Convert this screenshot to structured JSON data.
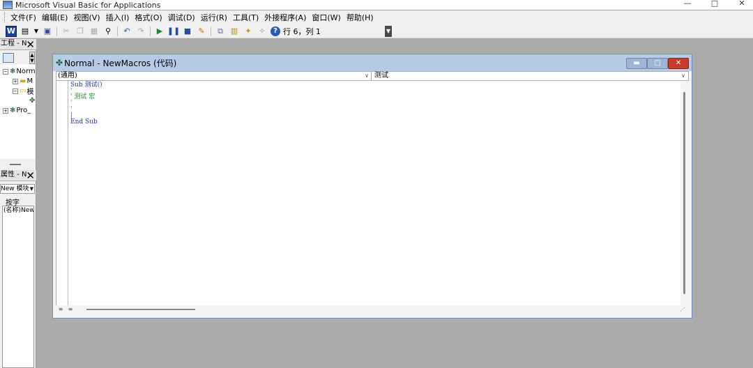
{
  "window": {
    "title": "Microsoft Visual Basic for Applications",
    "controls": {
      "minimize": "—",
      "maximize": "□",
      "close": "✕"
    }
  },
  "menu": [
    "文件(F)",
    "编辑(E)",
    "视图(V)",
    "插入(I)",
    "格式(O)",
    "调试(D)",
    "运行(R)",
    "工具(T)",
    "外接程序(A)",
    "窗口(W)",
    "帮助(H)"
  ],
  "toolbar": {
    "status": "行 6，列 1",
    "icons": [
      "word-icon",
      "insert-module-icon",
      "save-icon",
      "cut-icon",
      "copy-icon",
      "paste-icon",
      "find-icon",
      "undo-icon",
      "redo-icon",
      "run-icon",
      "break-icon",
      "reset-icon",
      "design-mode-icon",
      "project-explorer-icon",
      "properties-icon",
      "object-browser-icon",
      "toolbox-icon",
      "help-icon"
    ]
  },
  "project_panel": {
    "title": "工程 - N",
    "tree": [
      {
        "label": "Norm",
        "toggle": "−"
      },
      {
        "label": "M",
        "toggle": "+"
      },
      {
        "label": "模",
        "toggle": "−"
      },
      {
        "label": ""
      },
      {
        "label": "Pro_",
        "toggle": "+"
      }
    ]
  },
  "properties_panel": {
    "title": "属性 - N",
    "object": "New 模块",
    "tab": "按字",
    "row": "(名称)NewM"
  },
  "code_window": {
    "title": "Normal - NewMacros (代码)",
    "object_combo": "(通用)",
    "procedure_combo": "测试",
    "lines": [
      {
        "kind": "kw",
        "text": "Sub 测试()"
      },
      {
        "kind": "cm",
        "text": "'"
      },
      {
        "kind": "cm",
        "text": "' 测试 宏"
      },
      {
        "kind": "cm",
        "text": "'"
      },
      {
        "kind": "cm",
        "text": "'"
      },
      {
        "kind": "plain",
        "text": "|"
      },
      {
        "kind": "kw",
        "text": "End Sub"
      }
    ]
  }
}
